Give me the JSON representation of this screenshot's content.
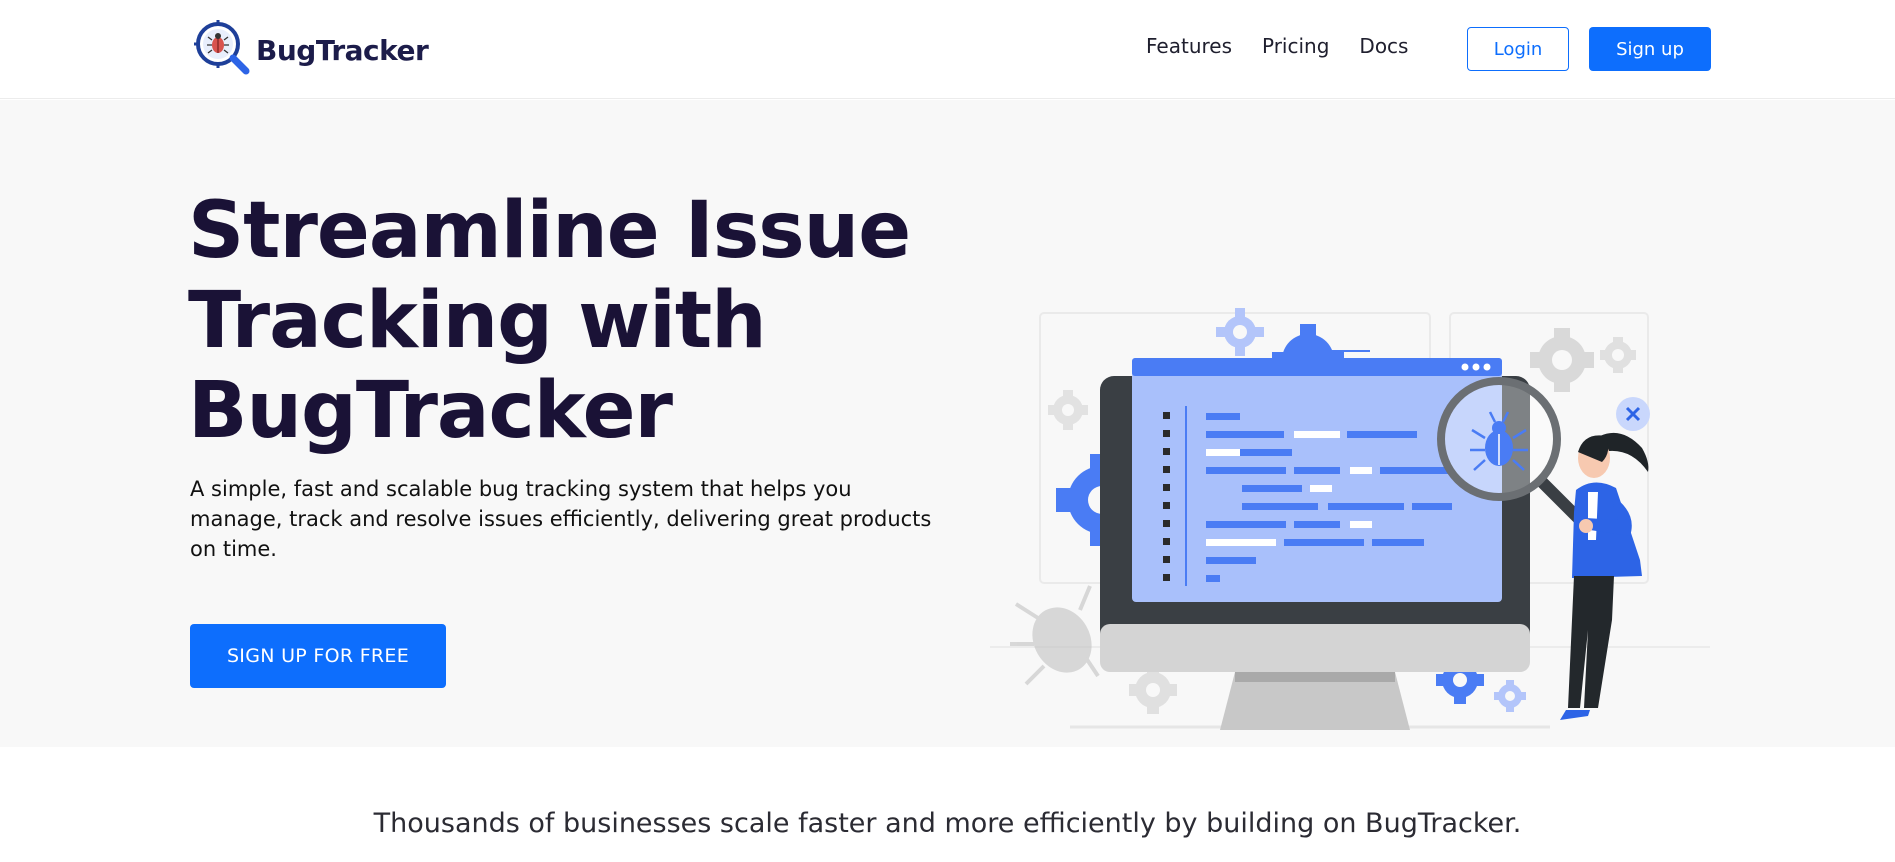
{
  "brand": {
    "name": "BugTracker",
    "logo_icon": "magnifier-bug-logo"
  },
  "nav": {
    "links": [
      "Features",
      "Pricing",
      "Docs"
    ],
    "login_label": "Login",
    "signup_label": "Sign up"
  },
  "hero": {
    "title_lines": [
      "Streamline Issue",
      "Tracking with",
      "BugTracker"
    ],
    "description": "A simple, fast and scalable bug tracking system that helps you manage, track and resolve issues efficiently, delivering great products on time.",
    "cta_label": "SIGN UP FOR FREE",
    "illustration_icon": "bug-inspection-illustration"
  },
  "tagline": "Thousands of businesses scale faster and more efficiently by building on BugTracker.",
  "colors": {
    "accent": "#0d6efd",
    "title": "#1a1236",
    "hero_bg": "#f8f8f8",
    "illustration_blue": "#4a7cf4",
    "illustration_light_blue": "#a9c0fb"
  }
}
